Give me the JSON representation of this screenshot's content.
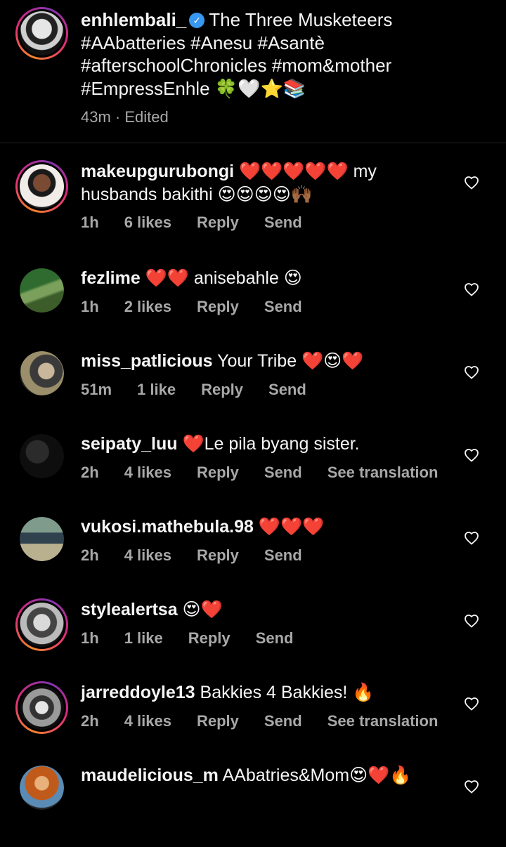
{
  "caption": {
    "username": "enhlembali_",
    "text_line1": "The Three Musketeers",
    "text_line2": "#AAbatteries #Anesu #Asantè",
    "text_line3": "#afterschoolChronicles #mom&mother",
    "text_line4": "#EmpressEnhle",
    "text_line4_emoji": "🍀🤍⭐📚",
    "time": "43m",
    "edited": "Edited",
    "separator": " · "
  },
  "colors": {
    "background": "#000000",
    "text": "#f5f5f5",
    "meta": "#a8a8a8",
    "verified": "#3897f0"
  },
  "comments": [
    {
      "username": "makeupgurubongi",
      "text": "❤️❤️❤️❤️❤️ my husbands bakithi 😍😍😍😍🙌🏾",
      "time": "1h",
      "likes": "6 likes",
      "reply": "Reply",
      "send": "Send",
      "translation": "",
      "avatar_ring": true
    },
    {
      "username": "fezlime",
      "text": "❤️❤️ anisebahle 😍",
      "time": "1h",
      "likes": "2 likes",
      "reply": "Reply",
      "send": "Send",
      "translation": "",
      "avatar_ring": false
    },
    {
      "username": "miss_patlicious",
      "text": "Your Tribe ❤️😍❤️",
      "time": "51m",
      "likes": "1 like",
      "reply": "Reply",
      "send": "Send",
      "translation": "",
      "avatar_ring": false
    },
    {
      "username": "seipaty_luu",
      "text": "❤️Le pila byang sister.",
      "time": "2h",
      "likes": "4 likes",
      "reply": "Reply",
      "send": "Send",
      "translation": "See translation",
      "avatar_ring": false
    },
    {
      "username": "vukosi.mathebula.98",
      "text": "❤️❤️❤️",
      "time": "2h",
      "likes": "4 likes",
      "reply": "Reply",
      "send": "Send",
      "translation": "",
      "avatar_ring": false
    },
    {
      "username": "stylealertsa",
      "text": "😍❤️",
      "time": "1h",
      "likes": "1 like",
      "reply": "Reply",
      "send": "Send",
      "translation": "",
      "avatar_ring": true
    },
    {
      "username": "jarreddoyle13",
      "text": "Bakkies 4 Bakkies! 🔥",
      "time": "2h",
      "likes": "4 likes",
      "reply": "Reply",
      "send": "Send",
      "translation": "See translation",
      "avatar_ring": true
    },
    {
      "username": "maudelicious_m",
      "text": "AAbatries&Mom😍❤️🔥",
      "time": "",
      "likes": "",
      "reply": "",
      "send": "",
      "translation": "",
      "avatar_ring": false
    }
  ],
  "icons": {
    "like": "heart-outline-icon",
    "verified": "verified-badge-icon"
  }
}
